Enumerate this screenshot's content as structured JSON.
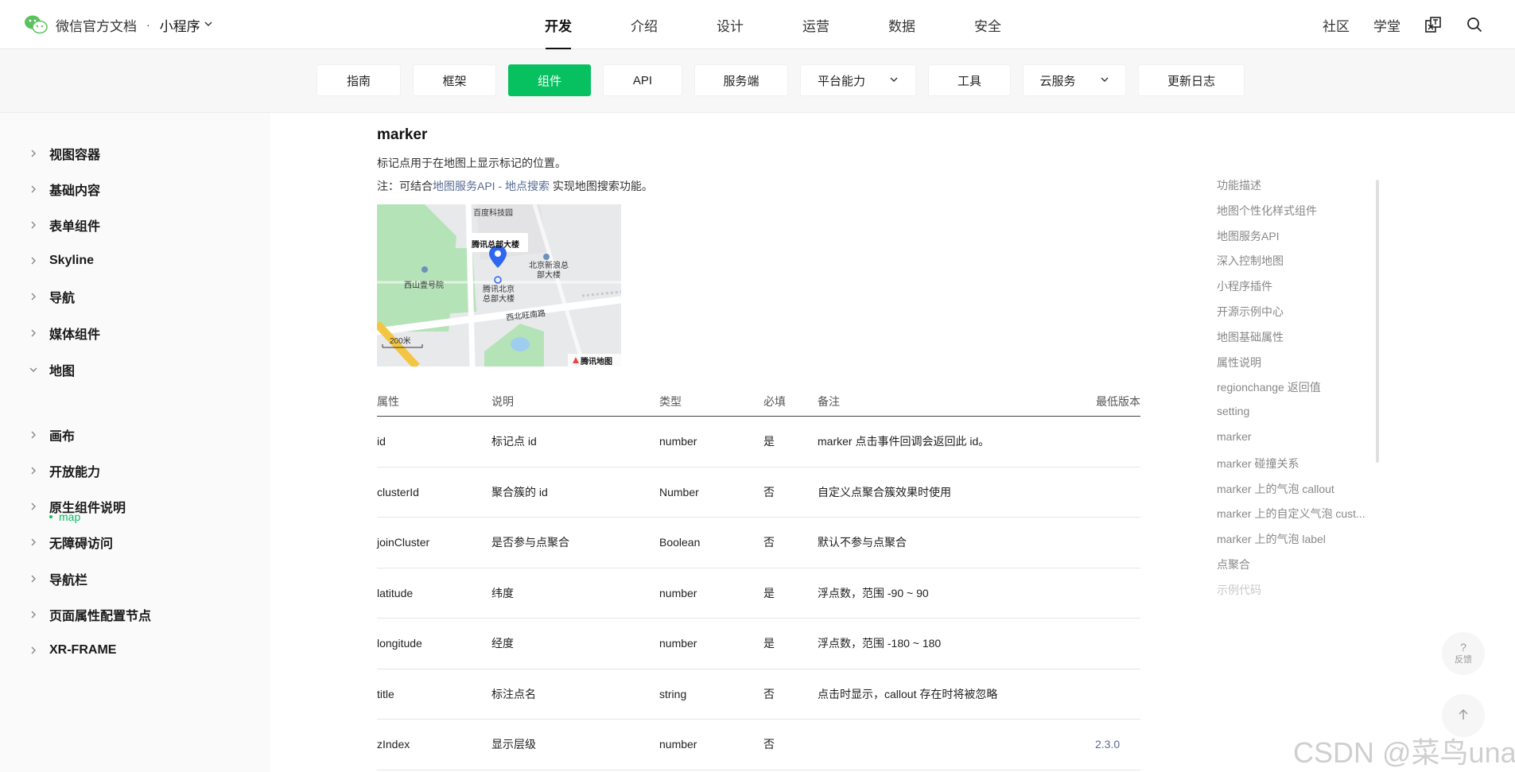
{
  "header": {
    "brand_text": "微信官方文档",
    "brand_dot": "·",
    "product": "小程序",
    "nav": [
      "开发",
      "介绍",
      "设计",
      "运营",
      "数据",
      "安全"
    ],
    "active_nav": "开发",
    "right": [
      "社区",
      "学堂"
    ]
  },
  "subnav": [
    {
      "label": "指南",
      "dropdown": false
    },
    {
      "label": "框架",
      "dropdown": false
    },
    {
      "label": "组件",
      "dropdown": false,
      "active": true
    },
    {
      "label": "API",
      "dropdown": false
    },
    {
      "label": "服务端",
      "dropdown": false
    },
    {
      "label": "平台能力",
      "dropdown": true
    },
    {
      "label": "工具",
      "dropdown": false
    },
    {
      "label": "云服务",
      "dropdown": true
    },
    {
      "label": "更新日志",
      "dropdown": false
    }
  ],
  "sidebar": {
    "items": [
      "视图容器",
      "基础内容",
      "表单组件",
      "Skyline",
      "导航",
      "媒体组件",
      "地图",
      "画布",
      "开放能力",
      "原生组件说明",
      "无障碍访问",
      "导航栏",
      "页面属性配置节点",
      "XR-FRAME"
    ],
    "expanded": "地图",
    "sub_item": "map"
  },
  "content": {
    "title": "marker",
    "desc": "标记点用于在地图上显示标记的位置。",
    "note_prefix": "注：可结合",
    "note_link": "地图服务API - 地点搜索",
    "note_suffix": " 实现地图搜索功能。",
    "map": {
      "labels": [
        "百度科技园",
        "腾讯总部大楼",
        "北京新浪总部大楼",
        "西山壹号院",
        "腾讯北京总部大楼",
        "西北旺南路",
        "200米",
        "腾讯地图"
      ]
    },
    "table": {
      "headers": [
        "属性",
        "说明",
        "类型",
        "必填",
        "备注",
        "最低版本"
      ],
      "rows": [
        [
          "id",
          "标记点 id",
          "number",
          "是",
          "marker 点击事件回调会返回此 id。",
          ""
        ],
        [
          "clusterId",
          "聚合簇的 id",
          "Number",
          "否",
          "自定义点聚合簇效果时使用",
          ""
        ],
        [
          "joinCluster",
          "是否参与点聚合",
          "Boolean",
          "否",
          "默认不参与点聚合",
          ""
        ],
        [
          "latitude",
          "纬度",
          "number",
          "是",
          "浮点数，范围 -90 ~ 90",
          ""
        ],
        [
          "longitude",
          "经度",
          "number",
          "是",
          "浮点数，范围 -180 ~ 180",
          ""
        ],
        [
          "title",
          "标注点名",
          "string",
          "否",
          "点击时显示，callout 存在时将被忽略",
          ""
        ],
        [
          "zIndex",
          "显示层级",
          "number",
          "否",
          "",
          "2.3.0"
        ]
      ]
    }
  },
  "toc": [
    "功能描述",
    "地图个性化样式组件",
    "地图服务API",
    "深入控制地图",
    "小程序插件",
    "开源示例中心",
    "地图基础属性",
    "属性说明",
    "regionchange 返回值",
    "setting",
    "marker",
    "marker 碰撞关系",
    "marker 上的气泡 callout",
    "marker 上的自定义气泡 cust...",
    "marker 上的气泡 label",
    "点聚合",
    "示例代码"
  ],
  "feedback": {
    "glyph": "?",
    "label": "反馈"
  },
  "watermark": "CSDN @菜鸟una",
  "colors": {
    "accent": "#07c160",
    "link": "#576b95"
  }
}
